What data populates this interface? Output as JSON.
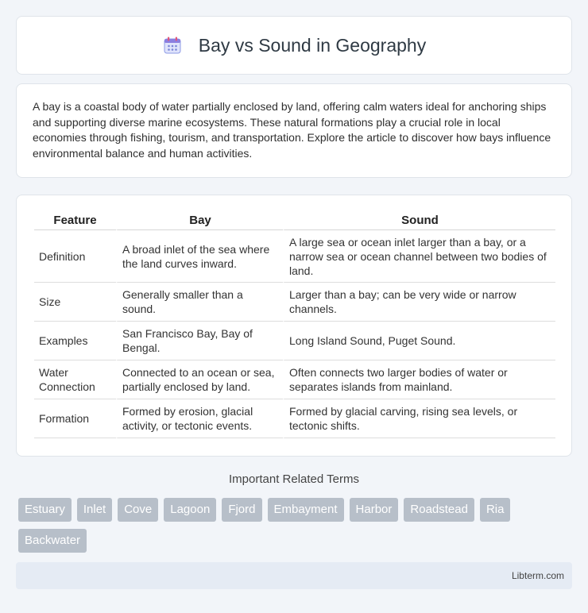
{
  "header": {
    "icon": "calendar-icon",
    "title": "Bay vs Sound in Geography"
  },
  "intro": {
    "text": "A bay is a coastal body of water partially enclosed by land, offering calm waters ideal for anchoring ships and supporting diverse marine ecosystems. These natural formations play a crucial role in local economies through fishing, tourism, and transportation. Explore the article to discover how bays influence environmental balance and human activities."
  },
  "table": {
    "headers": [
      "Feature",
      "Bay",
      "Sound"
    ],
    "rows": [
      [
        "Definition",
        "A broad inlet of the sea where the land curves inward.",
        "A large sea or ocean inlet larger than a bay, or a narrow sea or ocean channel between two bodies of land."
      ],
      [
        "Size",
        "Generally smaller than a sound.",
        "Larger than a bay; can be very wide or narrow channels."
      ],
      [
        "Examples",
        "San Francisco Bay, Bay of Bengal.",
        "Long Island Sound, Puget Sound."
      ],
      [
        "Water Connection",
        "Connected to an ocean or sea, partially enclosed by land.",
        "Often connects two larger bodies of water or separates islands from mainland."
      ],
      [
        "Formation",
        "Formed by erosion, glacial activity, or tectonic events.",
        "Formed by glacial carving, rising sea levels, or tectonic shifts."
      ]
    ]
  },
  "related": {
    "title": "Important Related Terms",
    "tags": [
      "Estuary",
      "Inlet",
      "Cove",
      "Lagoon",
      "Fjord",
      "Embayment",
      "Harbor",
      "Roadstead",
      "Ria",
      "Backwater"
    ]
  },
  "footer": {
    "site": "Libterm.com"
  },
  "colors": {
    "background": "#f2f5f9",
    "tag_bg": "#b7bfc9",
    "footer_bg": "#e5ebf4"
  }
}
